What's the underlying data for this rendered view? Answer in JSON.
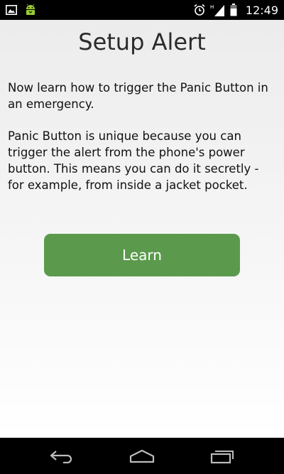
{
  "status_bar": {
    "time": "12:49",
    "icons": [
      "image-notification-icon",
      "android-debug-icon",
      "alarm-icon",
      "signal-icon",
      "battery-icon"
    ]
  },
  "main": {
    "title": "Setup Alert",
    "paragraph1": "Now learn how to trigger the Panic Button in an emergency.",
    "paragraph2": "Panic Button is unique because you can trigger the alert from the phone's power button. This means you can do it secretly - for example, from inside a jacket pocket.",
    "learn_button_label": "Learn"
  },
  "navigation": {
    "icons": [
      "back-icon",
      "home-icon",
      "recent-apps-icon"
    ]
  },
  "colors": {
    "accent": "#5b9a4d",
    "status_bar": "#000000",
    "android_green": "#9acd32"
  }
}
